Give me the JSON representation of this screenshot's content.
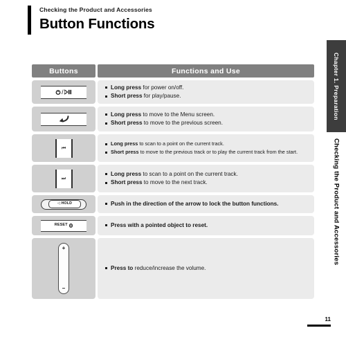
{
  "header": {
    "breadcrumb": "Checking the Product and Accessories",
    "title": "Button Functions"
  },
  "table": {
    "columns": {
      "buttons": "Buttons",
      "functions": "Functions and Use"
    },
    "rows": [
      {
        "icon": "power-play-pause-button-icon",
        "icon_label": "⏻/▷❙❙",
        "lines": [
          {
            "lead": "Long press",
            "rest": " for power on/off."
          },
          {
            "lead": "Short press",
            "rest": " for play/pause."
          }
        ]
      },
      {
        "icon": "return-back-button-icon",
        "icon_label": "↶",
        "lines": [
          {
            "lead": "Long press",
            "rest": " to move to the Menu screen."
          },
          {
            "lead": "Short press",
            "rest": " to move to the previous screen."
          }
        ]
      },
      {
        "icon": "previous-track-button-icon",
        "icon_label": "⏮",
        "small": true,
        "lines": [
          {
            "lead": "Long press",
            "rest": " to scan to a point on the current track."
          },
          {
            "lead": "Short press",
            "rest": " to move to the previous track or to play the current track from the start."
          }
        ]
      },
      {
        "icon": "next-track-button-icon",
        "icon_label": "⏭",
        "lines": [
          {
            "lead": "Long press",
            "rest": " to scan to a point on the current track."
          },
          {
            "lead": "Short press",
            "rest": " to move to the next track."
          }
        ]
      },
      {
        "icon": "hold-switch-icon",
        "icon_label": "HOLD",
        "icon_arrow": "◁",
        "lines": [
          {
            "lead": "Push in the direction of the arrow to lock the button functions.",
            "rest": ""
          }
        ]
      },
      {
        "icon": "reset-button-icon",
        "icon_label": "RESET",
        "lines": [
          {
            "lead": "Press with a pointed object to reset.",
            "rest": ""
          }
        ]
      },
      {
        "icon": "volume-rocker-icon",
        "icon_label_top": "+",
        "icon_label_bottom": "–",
        "lines": [
          {
            "lead": "Press to",
            "rest": " reduce/increase the volume."
          }
        ]
      }
    ]
  },
  "side_tabs": {
    "chapter": "Chapter 1. Preparation",
    "section": "Checking the Product and Accessories"
  },
  "footer": {
    "page_number": "11"
  },
  "colors": {
    "header_gray": "#808080",
    "button_cell_gray": "#d0d0d0",
    "desc_cell_gray": "#ebebeb",
    "chapter_tab_dark": "#3d3d3d"
  }
}
